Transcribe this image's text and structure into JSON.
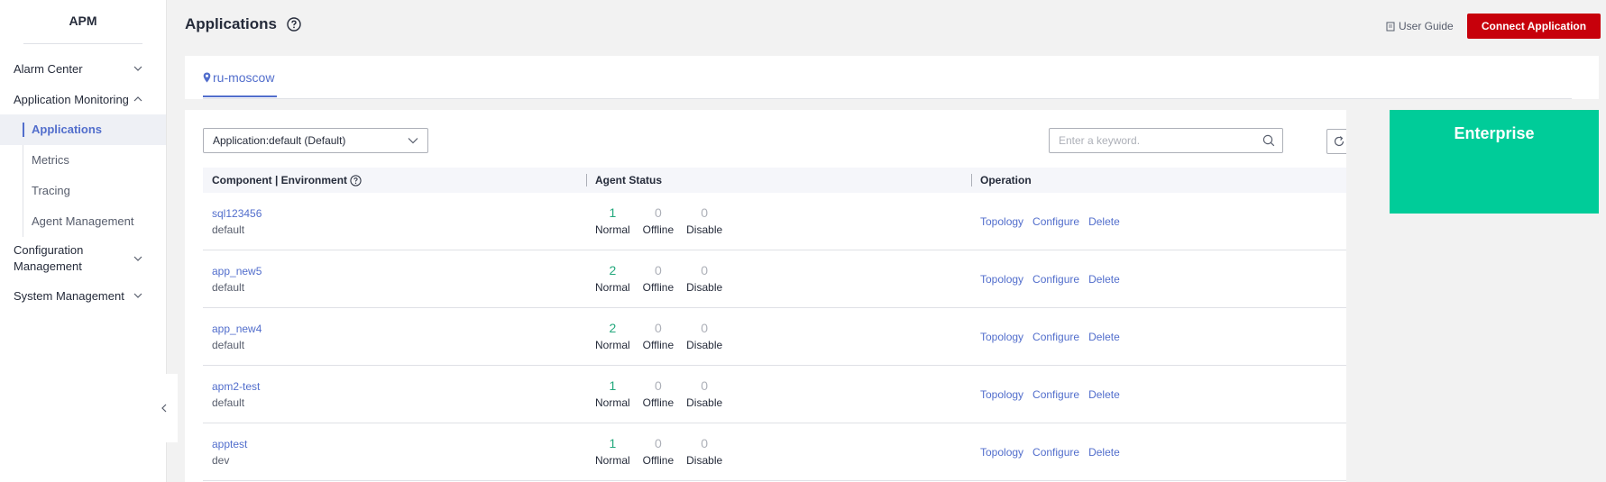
{
  "sidebar": {
    "title": "APM",
    "menu": [
      {
        "label": "Alarm Center",
        "expanded": false
      },
      {
        "label": "Application Monitoring",
        "expanded": true,
        "children": [
          "Applications",
          "Metrics",
          "Tracing",
          "Agent Management"
        ]
      },
      {
        "label_line1": "Configuration",
        "label_line2": "Management",
        "expanded": false
      },
      {
        "label": "System Management",
        "expanded": false
      }
    ],
    "active_child": "Applications"
  },
  "header": {
    "title": "Applications",
    "user_guide": "User Guide",
    "connect_button": "Connect Application"
  },
  "region": {
    "active_tab": "ru-moscow"
  },
  "filters": {
    "application_select": "Application:default (Default)",
    "search_placeholder": "Enter a keyword."
  },
  "table": {
    "headers": {
      "component": "Component | Environment",
      "agent_status": "Agent Status",
      "operation": "Operation"
    },
    "status_labels": {
      "normal": "Normal",
      "offline": "Offline",
      "disable": "Disable"
    },
    "operations": {
      "topology": "Topology",
      "configure": "Configure",
      "delete": "Delete"
    },
    "rows": [
      {
        "component": "sql123456",
        "environment": "default",
        "normal": "1",
        "offline": "0",
        "disable": "0"
      },
      {
        "component": "app_new5",
        "environment": "default",
        "normal": "2",
        "offline": "0",
        "disable": "0"
      },
      {
        "component": "app_new4",
        "environment": "default",
        "normal": "2",
        "offline": "0",
        "disable": "0"
      },
      {
        "component": "apm2-test",
        "environment": "default",
        "normal": "1",
        "offline": "0",
        "disable": "0"
      },
      {
        "component": "apptest",
        "environment": "dev",
        "normal": "1",
        "offline": "0",
        "disable": "0"
      }
    ]
  },
  "enterprise_card": {
    "label": "Enterprise",
    "color": "#00cc99"
  },
  "colors": {
    "brand_red": "#c7000b",
    "link_blue": "#526ecc",
    "status_green": "#24a87d"
  }
}
